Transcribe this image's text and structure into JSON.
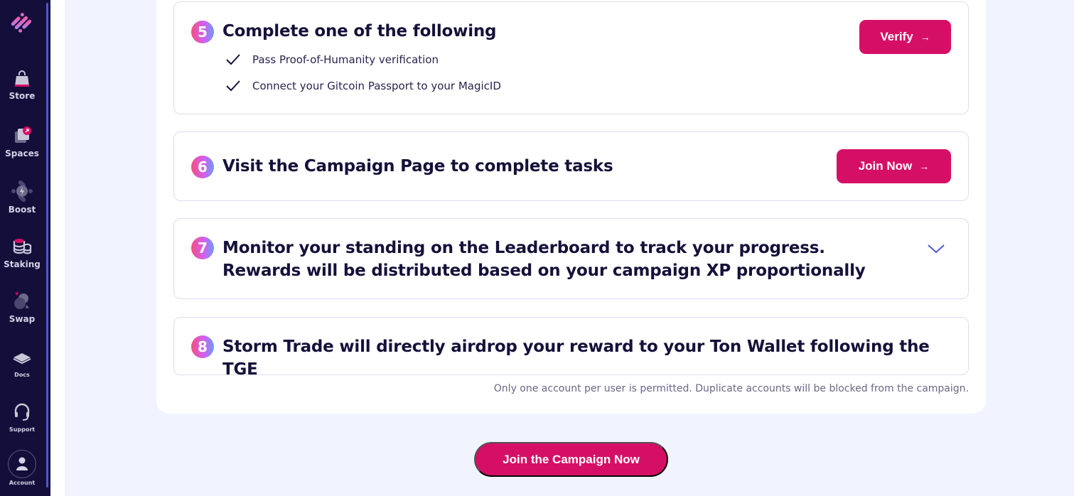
{
  "sidebar": {
    "items": [
      {
        "label": "Store",
        "icon": "shopping-bag-icon"
      },
      {
        "label": "Spaces",
        "icon": "spaces-icon"
      },
      {
        "label": "Boost",
        "icon": "boost-icon"
      },
      {
        "label": "Staking",
        "icon": "coins-stack-icon"
      },
      {
        "label": "Swap",
        "icon": "swap-icon"
      },
      {
        "label": "Docs",
        "icon": "book-icon"
      },
      {
        "label": "Support",
        "icon": "headset-icon"
      },
      {
        "label": "Account",
        "icon": "user-icon"
      }
    ]
  },
  "steps": [
    {
      "number": "5",
      "title": "Complete one of the following",
      "options": [
        "Pass Proof-of-Humanity verification",
        "Connect your Gitcoin Passport to your MagicID"
      ],
      "button": "Verify"
    },
    {
      "number": "6",
      "title": "Visit the Campaign Page to complete tasks",
      "button": "Join Now"
    },
    {
      "number": "7",
      "title_line1": "Monitor your standing on the Leaderboard to track your progress.",
      "title_line2": "Rewards will be distributed based on your campaign XP proportionally"
    },
    {
      "number": "8",
      "title": "Storm Trade will directly airdrop your reward to your Ton Wallet following the TGE"
    }
  ],
  "disclaimer": "Only one account per user is permitted. Duplicate accounts will be blocked from the campaign.",
  "cta": "Join the Campaign Now",
  "colors": {
    "accent": "#d60f66",
    "sidebar_bg": "#130f3a",
    "page_bg": "#f1f3fe",
    "chevron": "#4f5bd5"
  }
}
